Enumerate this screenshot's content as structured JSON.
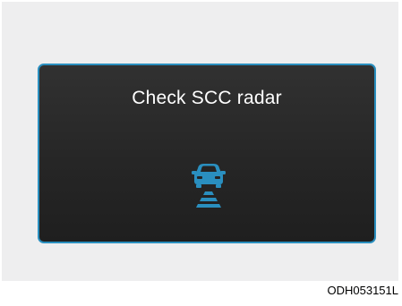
{
  "display": {
    "message": "Check SCC radar",
    "icon": "scc-radar-car-icon",
    "border_color": "#2a8fbf",
    "icon_color": "#2a8fbf"
  },
  "figure_code": "ODH053151L"
}
